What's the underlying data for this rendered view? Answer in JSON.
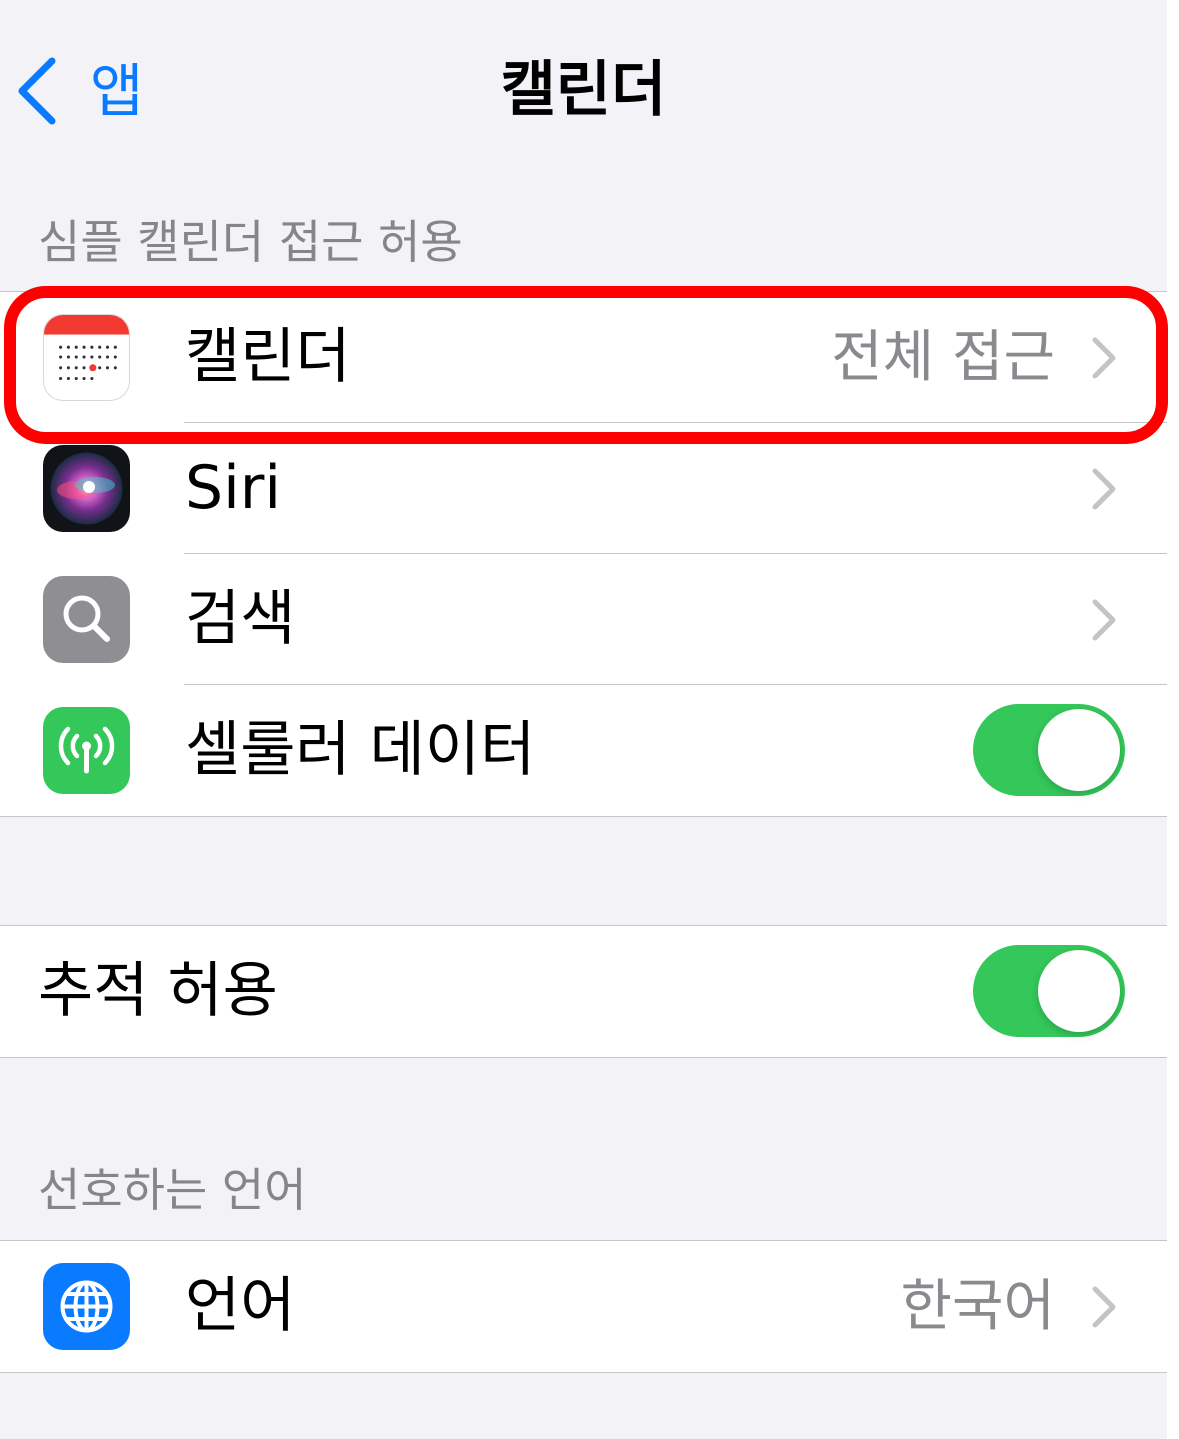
{
  "navbar": {
    "back_label": "앱",
    "title": "캘린더"
  },
  "sections": {
    "access_header": "심플 캘린더 접근 허용",
    "language_header": "선호하는 언어"
  },
  "access_rows": [
    {
      "label": "캘린더",
      "value": "전체 접근",
      "icon": "calendar-icon"
    },
    {
      "label": "Siri",
      "icon": "siri-icon"
    },
    {
      "label": "검색",
      "icon": "search-icon"
    },
    {
      "label": "셀룰러 데이터",
      "icon": "cellular-antenna-icon",
      "toggle_on": true
    }
  ],
  "tracking": {
    "label": "추적 허용",
    "toggle_on": true
  },
  "language": {
    "label": "언어",
    "value": "한국어",
    "icon": "globe-icon"
  },
  "colors": {
    "accent": "#0a7aff",
    "toggle_on": "#34c759",
    "highlight": "#ff0000",
    "background": "#f2f2f7"
  }
}
